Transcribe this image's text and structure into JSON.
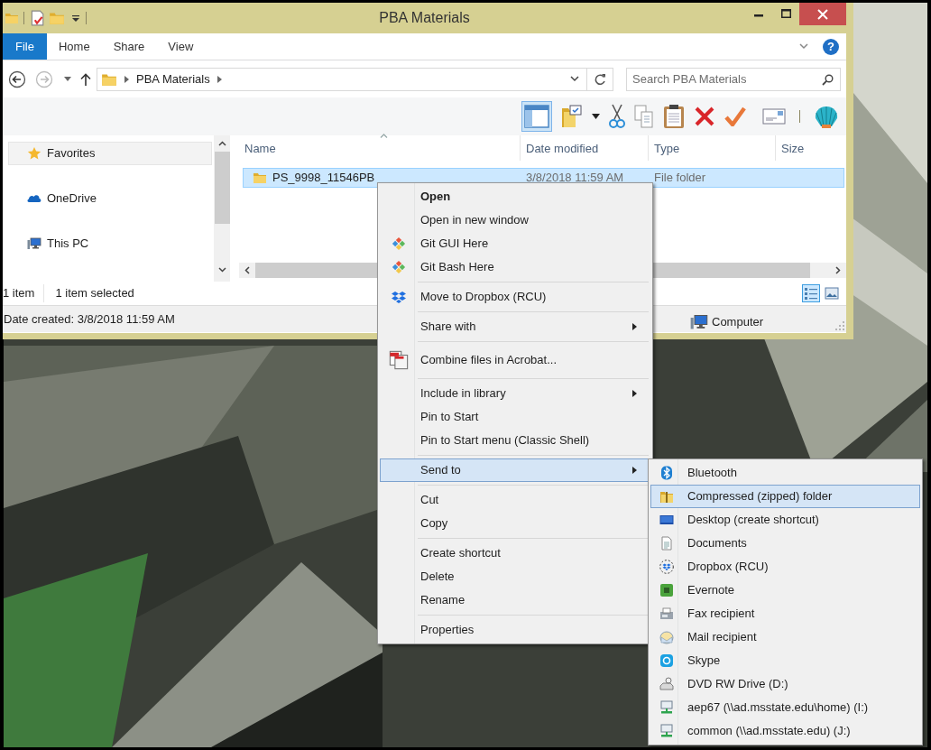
{
  "window": {
    "title": "PBA Materials",
    "help": "?"
  },
  "ribbon_tabs": [
    {
      "label": "File",
      "kind": "menu"
    },
    {
      "label": "Home",
      "kind": "tab"
    },
    {
      "label": "Share",
      "kind": "tab"
    },
    {
      "label": "View",
      "kind": "tab"
    }
  ],
  "address": {
    "path": [
      "PBA Materials"
    ]
  },
  "search": {
    "placeholder": "Search PBA Materials"
  },
  "nav_pane": [
    {
      "label": "Favorites",
      "kind": "star",
      "hover": true
    },
    {
      "label": "OneDrive",
      "kind": "cloud",
      "hover": false
    },
    {
      "label": "This PC",
      "kind": "pc",
      "hover": false
    }
  ],
  "columns": [
    {
      "label": "Name",
      "sorted": true
    },
    {
      "label": "Date modified",
      "sorted": false
    },
    {
      "label": "Type",
      "sorted": false
    },
    {
      "label": "Size",
      "sorted": false
    }
  ],
  "rows": [
    {
      "name": "PS_9998_11546PB",
      "date_modified": "3/8/2018 11:59 AM",
      "type": "File folder",
      "selected": true
    }
  ],
  "status_bar": {
    "count": "1 item",
    "selection": "1 item selected"
  },
  "view_buttons": [
    {
      "kind": "details",
      "selected": true
    },
    {
      "kind": "preview",
      "selected": false
    }
  ],
  "details_bar": {
    "info": "Date created: 3/8/2018 11:59 AM",
    "location": "Computer"
  },
  "context_menu": [
    [
      {
        "label": "Open",
        "default": true,
        "submenu": false,
        "kind": "none",
        "selected": false
      },
      {
        "label": "Open in new window",
        "default": false,
        "submenu": false,
        "kind": "none",
        "selected": false
      },
      {
        "label": "Git GUI Here",
        "default": false,
        "submenu": false,
        "kind": "git",
        "selected": false
      },
      {
        "label": "Git Bash Here",
        "default": false,
        "submenu": false,
        "kind": "git",
        "selected": false
      }
    ],
    [
      {
        "label": "Move to Dropbox (RCU)",
        "default": false,
        "submenu": false,
        "kind": "dropbox",
        "selected": false
      }
    ],
    [
      {
        "label": "Share with",
        "default": false,
        "submenu": true,
        "kind": "none",
        "selected": false
      }
    ],
    [
      {
        "label": "Combine files in Acrobat...",
        "default": false,
        "submenu": false,
        "kind": "acrobat",
        "selected": false
      }
    ],
    [
      {
        "label": "Include in library",
        "default": false,
        "submenu": true,
        "kind": "none",
        "selected": false
      },
      {
        "label": "Pin to Start",
        "default": false,
        "submenu": false,
        "kind": "none",
        "selected": false
      },
      {
        "label": "Pin to Start menu (Classic Shell)",
        "default": false,
        "submenu": false,
        "kind": "none",
        "selected": false
      }
    ],
    [
      {
        "label": "Send to",
        "default": false,
        "submenu": true,
        "kind": "none",
        "selected": true
      }
    ],
    [
      {
        "label": "Cut",
        "default": false,
        "submenu": false,
        "kind": "none",
        "selected": false
      },
      {
        "label": "Copy",
        "default": false,
        "submenu": false,
        "kind": "none",
        "selected": false
      }
    ],
    [
      {
        "label": "Create shortcut",
        "default": false,
        "submenu": false,
        "kind": "none",
        "selected": false
      },
      {
        "label": "Delete",
        "default": false,
        "submenu": false,
        "kind": "none",
        "selected": false
      },
      {
        "label": "Rename",
        "default": false,
        "submenu": false,
        "kind": "none",
        "selected": false
      }
    ],
    [
      {
        "label": "Properties",
        "default": false,
        "submenu": false,
        "kind": "none",
        "selected": false
      }
    ]
  ],
  "send_to": [
    {
      "label": "Bluetooth",
      "kind": "bluetooth",
      "selected": false
    },
    {
      "label": "Compressed (zipped) folder",
      "kind": "zip",
      "selected": true
    },
    {
      "label": "Desktop (create shortcut)",
      "kind": "desktop",
      "selected": false
    },
    {
      "label": "Documents",
      "kind": "documents",
      "selected": false
    },
    {
      "label": "Dropbox (RCU)",
      "kind": "dropbox_sync",
      "selected": false
    },
    {
      "label": "Evernote",
      "kind": "evernote",
      "selected": false
    },
    {
      "label": "Fax recipient",
      "kind": "fax",
      "selected": false
    },
    {
      "label": "Mail recipient",
      "kind": "mail",
      "selected": false
    },
    {
      "label": "Skype",
      "kind": "skype",
      "selected": false
    },
    {
      "label": "DVD RW Drive (D:)",
      "kind": "dvd",
      "selected": false
    },
    {
      "label": "aep67 (\\\\ad.msstate.edu\\home) (I:)",
      "kind": "network",
      "selected": false
    },
    {
      "label": "common (\\\\ad.msstate.edu) (J:)",
      "kind": "network",
      "selected": false
    }
  ]
}
